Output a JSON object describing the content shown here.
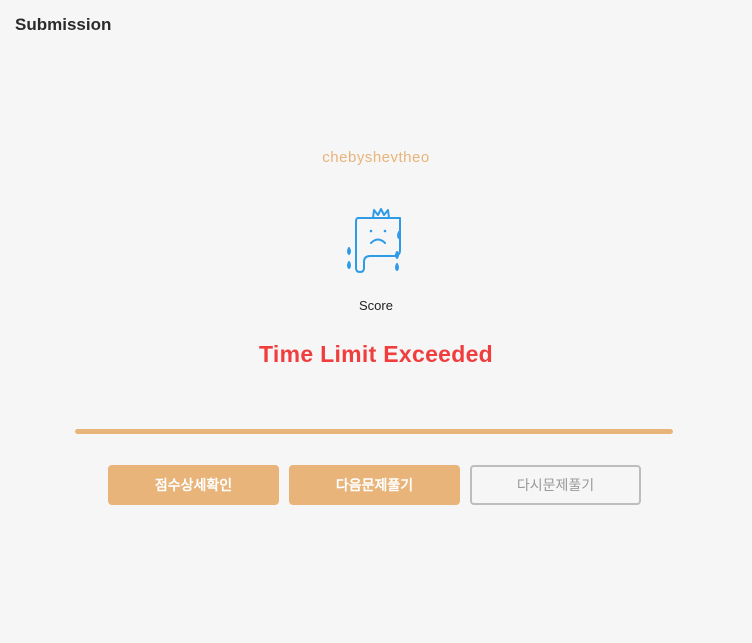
{
  "header": {
    "title": "Submission"
  },
  "result": {
    "username": "chebyshevtheo",
    "score_label": "Score",
    "status": "Time Limit Exceeded",
    "progress_fraction": 1.0
  },
  "buttons": {
    "score_detail": "점수상세확인",
    "next_problem": "다음문제풀기",
    "retry_problem": "다시문제풀기"
  },
  "icons": {
    "mascot": "sad-crying-mascot-icon"
  },
  "colors": {
    "accent": "#e8b47a",
    "error": "#f03e3e",
    "mascot": "#2f9be6",
    "background": "#f6f6f6"
  }
}
